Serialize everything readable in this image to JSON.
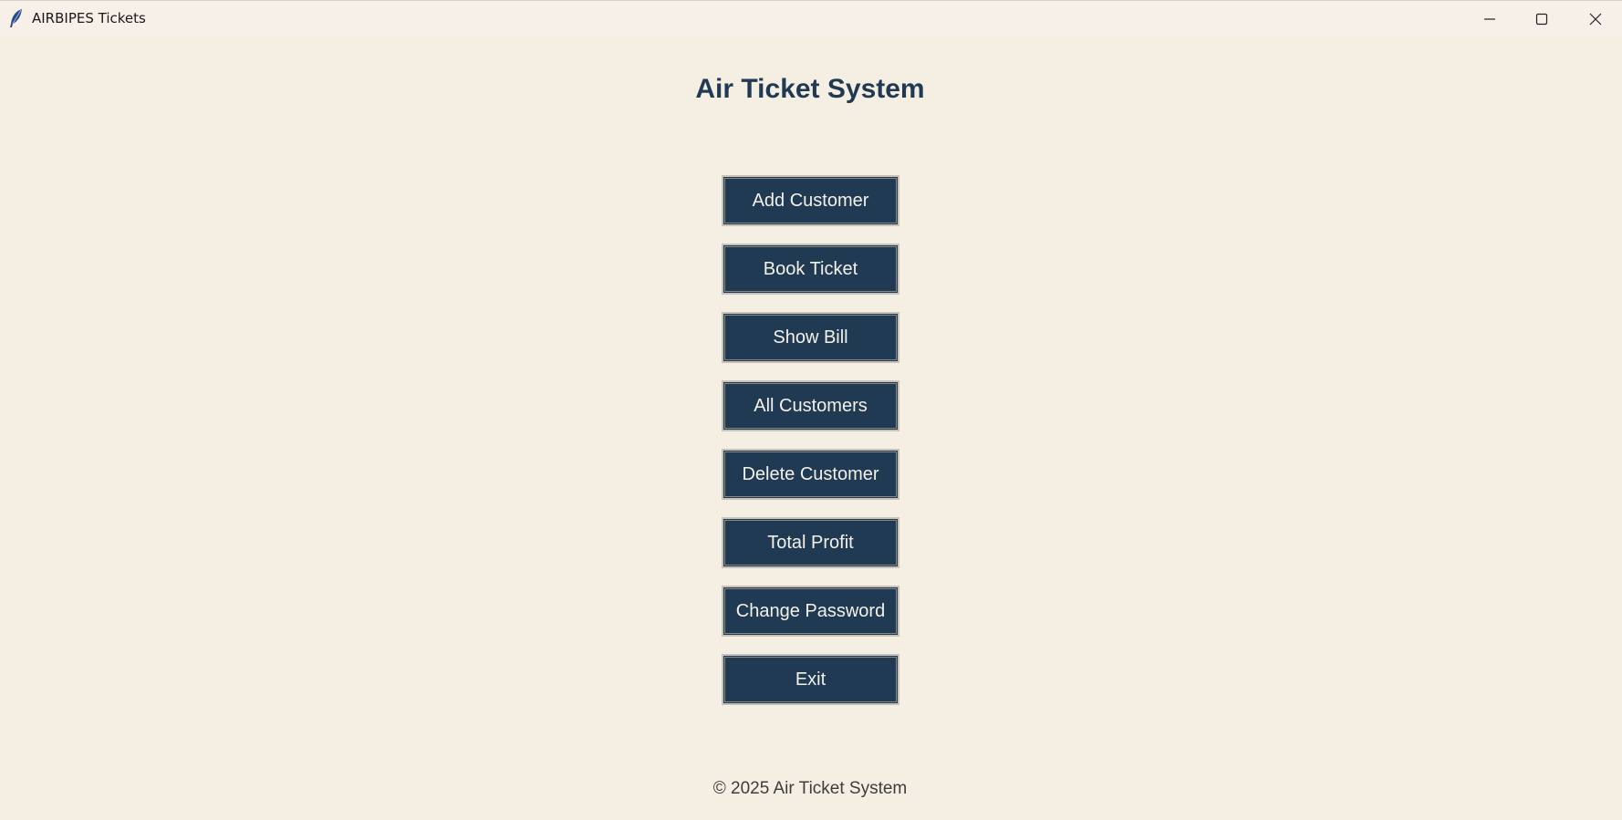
{
  "window": {
    "title": "AIRBIPES Tickets",
    "icon": "feather-icon",
    "controls": {
      "minimize": "minimize-icon",
      "maximize": "maximize-icon",
      "close": "close-icon"
    }
  },
  "main": {
    "title": "Air Ticket System",
    "buttons": [
      {
        "label": "Add Customer"
      },
      {
        "label": "Book Ticket"
      },
      {
        "label": "Show Bill"
      },
      {
        "label": "All Customers"
      },
      {
        "label": "Delete Customer"
      },
      {
        "label": "Total Profit"
      },
      {
        "label": "Change Password"
      },
      {
        "label": "Exit"
      }
    ]
  },
  "footer": {
    "text": "© 2025 Air Ticket System"
  },
  "colors": {
    "background": "#f5efe3",
    "button_bg": "#1f3a52",
    "button_text": "#f4f0ea",
    "title": "#1f3a52"
  }
}
